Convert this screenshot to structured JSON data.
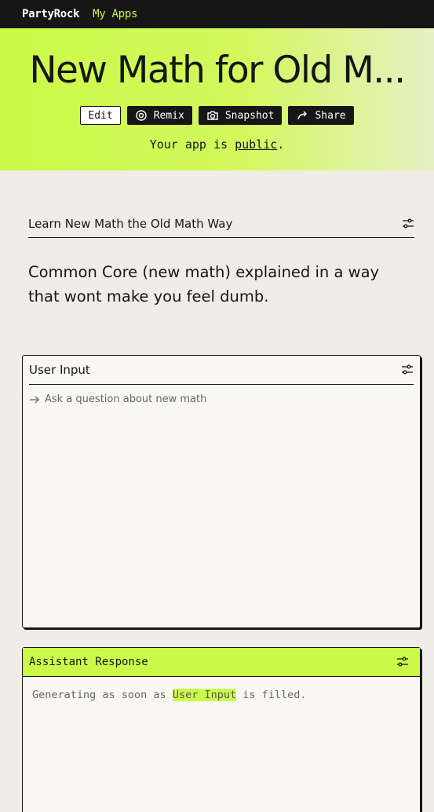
{
  "nav": {
    "brand": "PartyRock",
    "my_apps": "My Apps"
  },
  "header": {
    "title": "New Math for Old M...",
    "buttons": {
      "edit": "Edit",
      "remix": "Remix",
      "snapshot": "Snapshot",
      "share": "Share"
    },
    "visibility_prefix": "Your app is ",
    "visibility_link": "public",
    "visibility_suffix": "."
  },
  "description": {
    "heading": "Learn New Math the Old Math Way",
    "text": "Common Core (new math) explained in a way that wont make you feel dumb."
  },
  "user_input": {
    "title": "User Input",
    "placeholder": "Ask a question about new math"
  },
  "assistant": {
    "title": "Assistant Response",
    "status_prefix": "Generating as soon as ",
    "status_ref": "User Input",
    "status_suffix": " is filled."
  },
  "icons": [
    "settings-sliders-icon",
    "remix-icon",
    "camera-icon",
    "share-arrow-icon",
    "arrow-right-icon"
  ],
  "colors": {
    "accent": "#ccfa48",
    "dark": "#161616",
    "background": "#f0ede6",
    "card": "#f8f7f1"
  }
}
